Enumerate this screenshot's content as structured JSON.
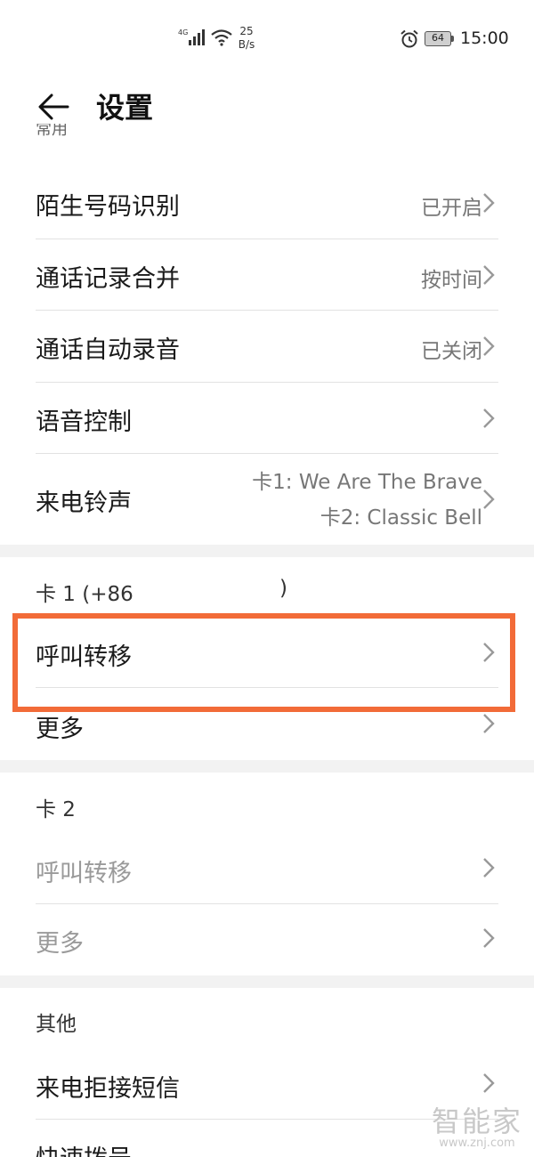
{
  "status_bar": {
    "network": "4G",
    "speed_value": "25",
    "speed_unit": "B/s",
    "battery": "64",
    "time": "15:00"
  },
  "header": {
    "title": "设置"
  },
  "general_section": {
    "clipped_title": "常用",
    "items": [
      {
        "label": "陌生号码识别",
        "value": "已开启"
      },
      {
        "label": "通话记录合并",
        "value": "按时间"
      },
      {
        "label": "通话自动录音",
        "value": "已关闭"
      },
      {
        "label": "语音控制",
        "value": ""
      },
      {
        "label": "来电铃声",
        "value_lines": [
          "卡1: We Are The Brave",
          "卡2: Classic Bell"
        ]
      }
    ]
  },
  "card1_section": {
    "title_prefix": "卡 1 (+86",
    "title_suffix": ")",
    "items": [
      {
        "label": "呼叫转移"
      },
      {
        "label": "更多"
      }
    ]
  },
  "card2_section": {
    "title": "卡 2",
    "items": [
      {
        "label": "呼叫转移"
      },
      {
        "label": "更多"
      }
    ]
  },
  "other_section": {
    "title": "其他",
    "items": [
      {
        "label": "来电拒接短信"
      },
      {
        "label": "快速拨号"
      }
    ]
  },
  "colors": {
    "highlight": "#f26b38",
    "disabled_text": "#9a9a9a"
  },
  "watermark": {
    "main": "智能家",
    "sub": "www.znj.com"
  }
}
